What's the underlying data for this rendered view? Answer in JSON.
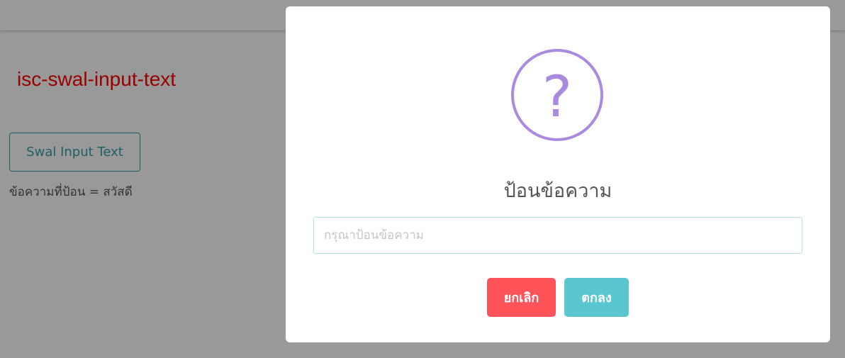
{
  "page": {
    "component_label": "isc-swal-input-text",
    "open_button_label": "Swal Input Text",
    "result_text": "ข้อความที่ป้อน = สวัสดี"
  },
  "dialog": {
    "icon": "question-icon",
    "icon_glyph": "?",
    "title": "ป้อนข้อความ",
    "input": {
      "value": "",
      "placeholder": "กรุณาป้อนข้อความ"
    },
    "cancel_label": "ยกเลิก",
    "confirm_label": "ตกลง"
  },
  "colors": {
    "label_text": "#ff0000",
    "outline_button": "#3a9ea3",
    "icon": "#a98adf",
    "cancel_button": "#fe5358",
    "confirm_button": "#59c6d0",
    "overlay": "rgba(0,0,0,0.4)"
  }
}
